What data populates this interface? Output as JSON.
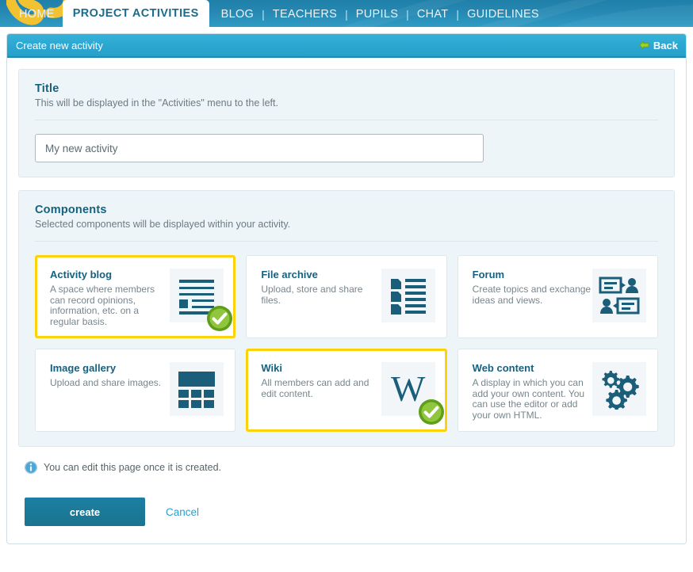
{
  "nav": {
    "home": "HOME",
    "active_tab": "PROJECT ACTIVITIES",
    "separator": "|",
    "links": [
      "BLOG",
      "TEACHERS",
      "PUPILS",
      "CHAT",
      "GUIDELINES"
    ]
  },
  "header": {
    "title": "Create new activity",
    "back_label": "Back",
    "back_icon": "arrow-left-icon",
    "bar_color": "#2ba6d0"
  },
  "title_section": {
    "heading": "Title",
    "description": "This will be displayed in the \"Activities\" menu to the left.",
    "input_value": "My new activity"
  },
  "components_section": {
    "heading": "Components",
    "description": "Selected components will be displayed within your activity.",
    "selected_border_color": "#fcd20a",
    "cards": [
      {
        "name": "Activity blog",
        "description": "A space where members can record opinions, information, etc. on a regular basis.",
        "icon": "blog-lines-icon",
        "selected": true
      },
      {
        "name": "File archive",
        "description": "Upload, store and share files.",
        "icon": "file-list-icon",
        "selected": false
      },
      {
        "name": "Forum",
        "description": "Create topics and exchange ideas and views.",
        "icon": "forum-speech-people-icon",
        "selected": false
      },
      {
        "name": "Image gallery",
        "description": "Upload and share images.",
        "icon": "image-grid-icon",
        "selected": false
      },
      {
        "name": "Wiki",
        "description": "All members can add and edit content.",
        "icon": "wiki-w-icon",
        "selected": true
      },
      {
        "name": "Web content",
        "description": "A display in which you can add your own content. You can use the editor or add your own HTML.",
        "icon": "gears-icon",
        "selected": false
      }
    ]
  },
  "footer": {
    "note_icon": "info-icon",
    "note": "You can edit this page once it is created.",
    "create_label": "create",
    "cancel_label": "Cancel"
  }
}
